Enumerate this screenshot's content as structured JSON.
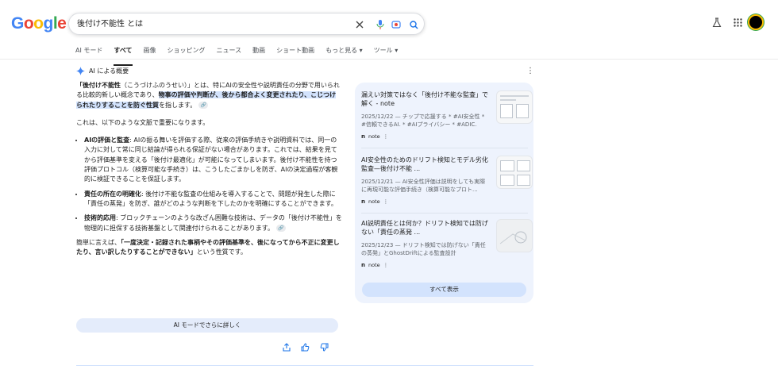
{
  "logo": {
    "letters": [
      "G",
      "o",
      "o",
      "g",
      "l",
      "e"
    ],
    "colors": [
      "#4285f4",
      "#ea4335",
      "#fbbc05",
      "#4285f4",
      "#34a853",
      "#ea4335"
    ]
  },
  "search": {
    "value": "後付け不能性 とは"
  },
  "tabs": [
    "AI モード",
    "すべて",
    "画像",
    "ショッピング",
    "ニュース",
    "動画",
    "ショート動画",
    "もっと見る ▾",
    "ツール ▾"
  ],
  "ai": {
    "header": "AI による概要",
    "intro_a": "「後付け不能性",
    "intro_b": "（こうづけふのうせい）」とは、特にAIの安全性や説明責任の分野で用いられる比較的新しい概念であり、",
    "intro_hl": "物事の評価や判断が、後から都合よく変更されたり、こじつけられたりすることを防ぐ性質",
    "intro_c": "を指します。",
    "context": "これは、以下のような文脈で重要になります。",
    "bullets": [
      {
        "label": "AIの評価と監査",
        "text": ": AIの振る舞いを評価する際、従来の評価手続きや説明資料では、同一の入力に対して常に同じ結論が得られる保証がない場合があります。これでは、結果を見てから評価基準を変える「後付け最適化」が可能になってしまいます。後付け不能性を持つ評価プロトコル（検算可能な手続き）は、こうしたごまかしを防ぎ、AIの決定過程が客観的に検証できることを保証します。"
      },
      {
        "label": "責任の所在の明確化",
        "text": ": 後付け不能な監査の仕組みを導入することで、問題が発生した際に「責任の蒸発」を防ぎ、誰がどのような判断を下したのかを明確にすることができます。"
      },
      {
        "label": "技術的応用",
        "text": ": ブロックチェーンのような改ざん困難な技術は、データの「後付け不能性」を物理的に担保する技術基盤として関連付けられることがあります。"
      }
    ],
    "summary_a": "簡単に言えば、",
    "summary_b": "「一度決定・記録された事柄やその評価基準を、後になってから不正に変更したり、言い訳したりすることができない」",
    "summary_c": "という性質です。",
    "more_button": "AI モードでさらに詳しく"
  },
  "sources": {
    "cards": [
      {
        "title": "漏えい対策ではなく「後付け不能な監査」で解く - note",
        "snippet": "2025/12/22 — チップで応援する * #AI安全性 * #信頼できるAI. * #AIプライバシー * #ADIC.",
        "source": "note"
      },
      {
        "title": "AI安全性のためのドリフト検知とモデル劣化監査—後付け不能 ...",
        "snippet": "2025/12/21 — AI安全性評価は説明をしても実際に再現可能な評価手続き（検算可能なプロト...",
        "source": "note"
      },
      {
        "title": "AI説明責任とは何か？ドリフト検知では防げない「責任の蒸発 ...",
        "snippet": "2025/12/23 — ドリフト検知では防げない「責任の蒸発」とGhostDriftによる監査設計",
        "source": "note"
      }
    ],
    "show_all": "すべて表示"
  }
}
